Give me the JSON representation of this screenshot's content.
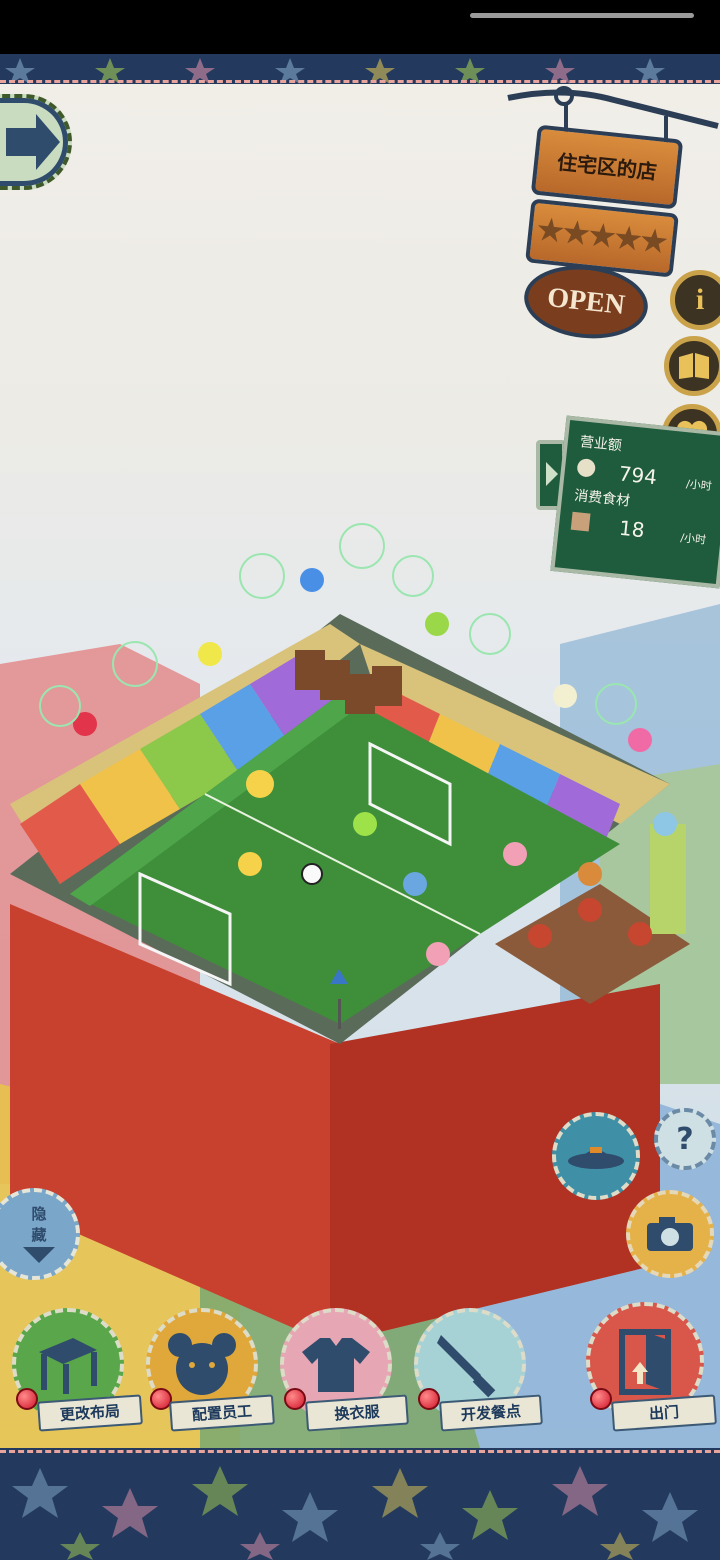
{
  "shop": {
    "sign_name": "住宅区的店",
    "open_label": "OPEN",
    "rating_stars": 5
  },
  "stats": {
    "revenue_label": "营业额",
    "revenue_value": "794",
    "revenue_unit": "/小时",
    "ingredients_label": "消费食材",
    "ingredients_value": "18",
    "ingredients_unit": "/小时"
  },
  "side_buttons": {
    "info_label": "i"
  },
  "controls": {
    "hide_label_line1": "隐",
    "hide_label_line2": "藏",
    "help_label": "?"
  },
  "menu": {
    "items": [
      {
        "label": "更改布局"
      },
      {
        "label": "配置员工"
      },
      {
        "label": "换衣服"
      },
      {
        "label": "开发餐点"
      },
      {
        "label": "出门"
      }
    ]
  },
  "colors": {
    "band": "#233a5e",
    "board_green": "#1f5b3d",
    "wood": "#c8762f",
    "pitch_green": "#3f8f3a"
  }
}
